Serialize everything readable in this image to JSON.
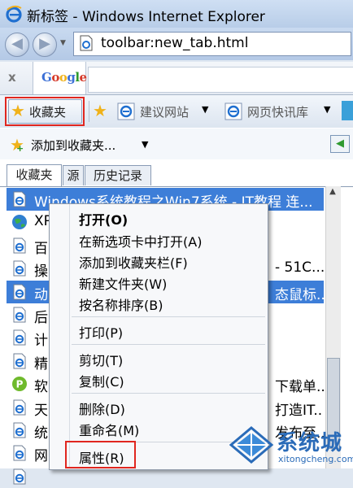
{
  "window": {
    "title": "新标签 - Windows Internet Explorer"
  },
  "address": {
    "value": "toolbar:new_tab.html"
  },
  "google": {
    "close": "x",
    "logo": "Google"
  },
  "favbar": {
    "favorites_label": "收藏夹",
    "suggested_label": "建议网站",
    "webslice_label": "网页快讯库"
  },
  "panel": {
    "add_to_favorites": "添加到收藏夹...",
    "tabs": [
      "收藏夹",
      "源",
      "历史记录"
    ]
  },
  "list": {
    "items": [
      {
        "text": "Windows系统教程之Win7系统 - IT教程 连...",
        "icon": "ie-page-icon",
        "selected": true
      },
      {
        "text": "XP",
        "icon": "globe-icon",
        "selected": false
      },
      {
        "text": "百",
        "icon": "ie-page-icon",
        "selected": false
      },
      {
        "text": "操",
        "icon": "ie-page-icon",
        "selected": false,
        "tail": "- 51C..."
      },
      {
        "text": "动",
        "icon": "ie-page-icon",
        "selected": true,
        "tail": "态鼠标..."
      },
      {
        "text": "后",
        "icon": "ie-page-icon",
        "selected": false
      },
      {
        "text": "计",
        "icon": "ie-page-icon",
        "selected": false
      },
      {
        "text": "精",
        "icon": "ie-page-icon",
        "selected": false
      },
      {
        "text": "软",
        "icon": "green-p-icon",
        "selected": false,
        "tail": "下载单..."
      },
      {
        "text": "天",
        "icon": "ie-page-icon",
        "selected": false,
        "tail": "打造IT..."
      },
      {
        "text": "统",
        "icon": "ie-page-icon",
        "selected": false,
        "tail": "发布至..."
      },
      {
        "text": "网",
        "icon": "ie-page-icon",
        "selected": false
      },
      {
        "text": "",
        "icon": "ie-page-icon",
        "selected": false
      }
    ]
  },
  "context_menu": {
    "open": "打开(O)",
    "open_new_tab": "在新选项卡中打开(A)",
    "add_to_fav_bar": "添加到收藏夹栏(F)",
    "new_folder": "新建文件夹(W)",
    "sort_by_name": "按名称排序(B)",
    "print": "打印(P)",
    "cut": "剪切(T)",
    "copy": "复制(C)",
    "delete": "删除(D)",
    "rename": "重命名(M)",
    "properties": "属性(R)"
  },
  "watermark": {
    "name": "系统城",
    "url": "xitongcheng.com"
  },
  "colors": {
    "selection": "#3d7ed8",
    "highlight_box": "#e0261f"
  }
}
